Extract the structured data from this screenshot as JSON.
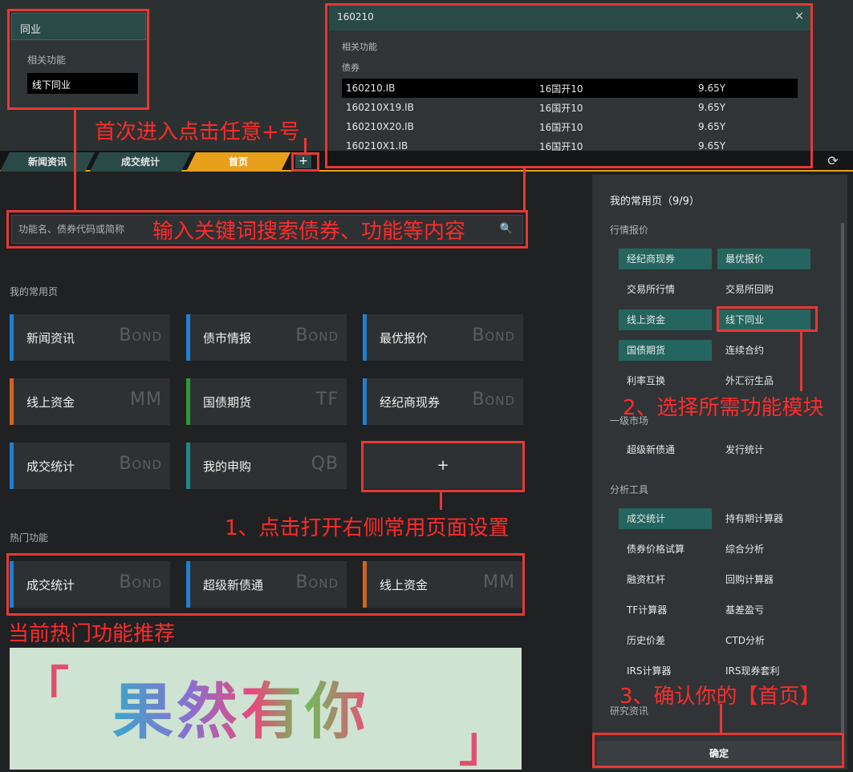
{
  "tabs": [
    {
      "label": "新闻资讯"
    },
    {
      "label": "成交统计"
    },
    {
      "label": "首页"
    }
  ],
  "tab_plus_label": "+",
  "peer_popup": {
    "title": "同业",
    "section": "相关功能",
    "hit": "线下同业"
  },
  "bond_popup": {
    "title": "160210",
    "close": "×",
    "section1": "相关功能",
    "section2": "债券",
    "rows": [
      {
        "code": "160210.IB",
        "name": "16国开10",
        "term": "9.65Y"
      },
      {
        "code": "160210X19.IB",
        "name": "16国开10",
        "term": "9.65Y"
      },
      {
        "code": "160210X20.IB",
        "name": "16国开10",
        "term": "9.65Y"
      },
      {
        "code": "160210X1.IB",
        "name": "16国开10",
        "term": "9.65Y"
      }
    ]
  },
  "search": {
    "placeholder": "功能名、债券代码或简称"
  },
  "my_pages": {
    "label": "我的常用页",
    "cards": [
      {
        "name": "新闻资讯",
        "tag": "Bond",
        "color": "#1f7fd0"
      },
      {
        "name": "债市情报",
        "tag": "Bond",
        "color": "#1f7fd0"
      },
      {
        "name": "最优报价",
        "tag": "Bond",
        "color": "#1f7fd0"
      },
      {
        "name": "线上资金",
        "tag": "MM",
        "color": "#d0641f"
      },
      {
        "name": "国债期货",
        "tag": "TF",
        "color": "#2a9a3a"
      },
      {
        "name": "经纪商现券",
        "tag": "Bond",
        "color": "#1f7fd0"
      },
      {
        "name": "成交统计",
        "tag": "Bond",
        "color": "#1f7fd0"
      },
      {
        "name": "我的申购",
        "tag": "QB",
        "color": "#1a8a8a"
      }
    ],
    "add_label": "+"
  },
  "hot": {
    "label": "热门功能",
    "cards": [
      {
        "name": "成交统计",
        "tag": "Bond",
        "color": "#1f7fd0"
      },
      {
        "name": "超级新债通",
        "tag": "Bond",
        "color": "#1f7fd0"
      },
      {
        "name": "线上资金",
        "tag": "MM",
        "color": "#d0641f"
      }
    ]
  },
  "banner": {
    "text": "果然有你",
    "left_bracket": "「",
    "right_bracket": "」"
  },
  "right_panel": {
    "title": "我的常用页（9/9）",
    "sec_quote": "行情报价",
    "quote_items": [
      "经纪商现券",
      "最优报价",
      "交易所行情",
      "交易所回购",
      "线上资金",
      "线下同业",
      "国债期货",
      "连续合约",
      "利率互换",
      "外汇衍生品"
    ],
    "sec_primary": "一级市场",
    "primary_items": [
      "超级新债通",
      "发行统计"
    ],
    "sec_tools": "分析工具",
    "tool_items": [
      "成交统计",
      "持有期计算器",
      "债券价格试算",
      "综合分析",
      "融资杠杆",
      "回购计算器",
      "TF计算器",
      "基差盈亏",
      "历史价差",
      "CTD分析",
      "IRS计算器",
      "IRS现券套利"
    ],
    "sec_research": "研究资讯",
    "confirm": "确定"
  },
  "annotations": {
    "first_enter": "首次进入点击任意+号",
    "search_hint": "输入关键词搜索债券、功能等内容",
    "step1": "1、点击打开右侧常用页面设置",
    "hot_hint": "当前热门功能推荐",
    "step2": "2、选择所需功能模块",
    "step3": "3、确认你的【首页】"
  },
  "colors": {
    "accent": "#e8a01c",
    "teal": "#24655f",
    "annotation_red": "#e53935"
  }
}
